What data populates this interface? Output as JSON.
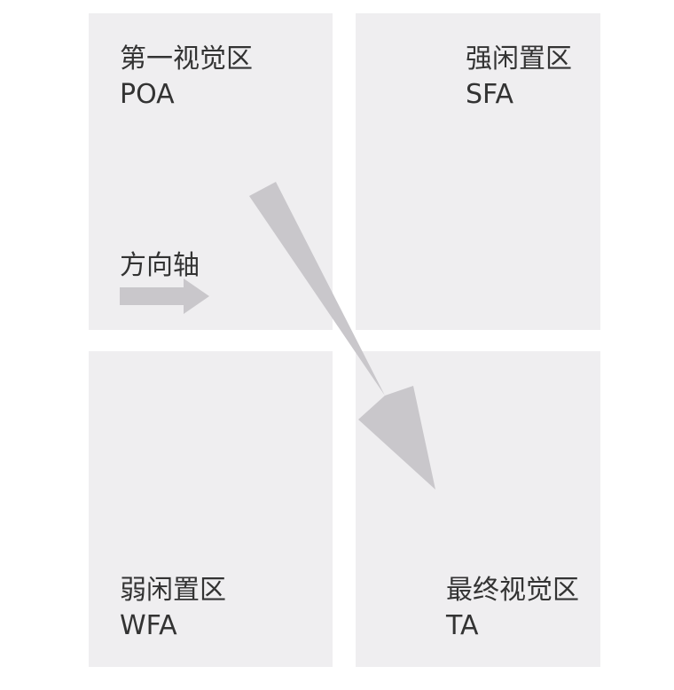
{
  "zones": {
    "top_left": {
      "zh": "第一视觉区",
      "en": "POA"
    },
    "top_right": {
      "zh": "强闲置区",
      "en": "SFA"
    },
    "bottom_left": {
      "zh": "弱闲置区",
      "en": "WFA"
    },
    "bottom_right": {
      "zh": "最终视觉区",
      "en": "TA"
    }
  },
  "axis_label": "方向轴",
  "colors": {
    "panel": "#efeef0",
    "arrow": "#c9c7cb",
    "text": "#333333"
  }
}
